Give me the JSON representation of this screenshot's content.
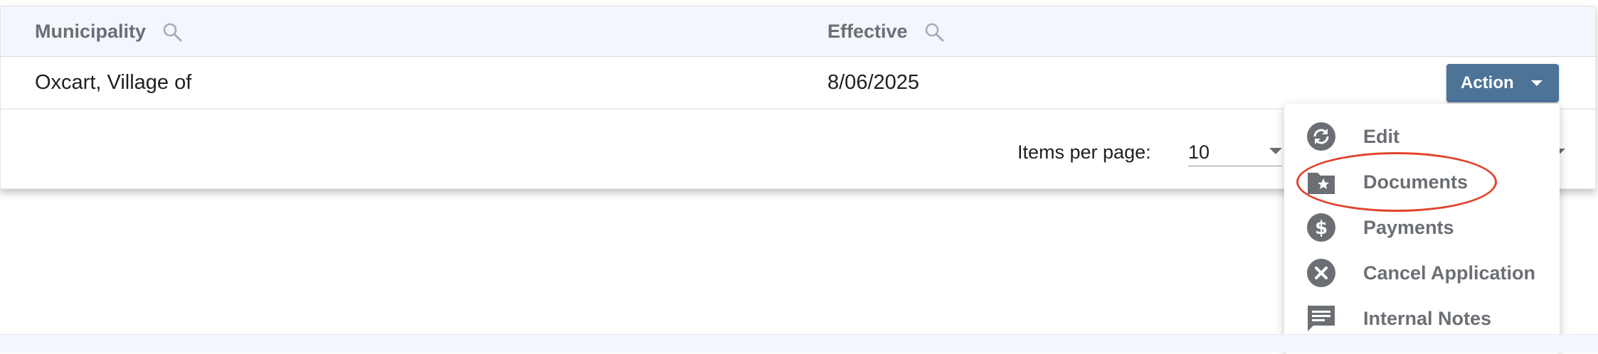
{
  "table": {
    "columns": [
      {
        "label": "Municipality",
        "icon": "search-icon"
      },
      {
        "label": "Effective",
        "icon": "search-icon"
      }
    ],
    "rows": [
      {
        "municipality": "Oxcart, Village of",
        "effective": "8/06/2025",
        "action_label": "Action"
      }
    ]
  },
  "pagination": {
    "items_per_page_label": "Items per page:",
    "items_per_page_value": "10"
  },
  "action_menu": {
    "items": [
      {
        "label": "Edit",
        "icon": "sync-icon"
      },
      {
        "label": "Documents",
        "icon": "folder-star-icon"
      },
      {
        "label": "Payments",
        "icon": "dollar-circle-icon"
      },
      {
        "label": "Cancel Application",
        "icon": "cancel-circle-icon"
      },
      {
        "label": "Internal Notes",
        "icon": "note-comment-icon"
      }
    ],
    "highlighted": "Documents",
    "highlight_color": "#e0442b"
  },
  "colors": {
    "header_bg": "#f2f7fd",
    "action_button_bg": "#4d7397",
    "icon_gray": "#6b6f74"
  }
}
